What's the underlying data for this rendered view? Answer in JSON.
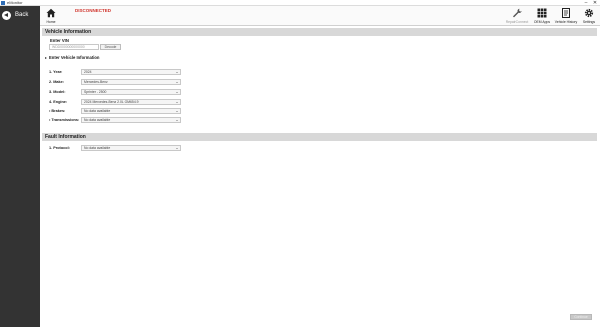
{
  "window": {
    "title": "eMonitor",
    "minimize": "–",
    "close": "✕"
  },
  "sidebar": {
    "back_label": "Back"
  },
  "toolbar": {
    "home_label": "Home",
    "status": "DISCONNECTED",
    "repair_connect_label": "RepairConnect",
    "oem_apps_label": "OEM Apps",
    "vehicle_history_label": "Vehicle History",
    "settings_label": "Settings"
  },
  "vehicle_info": {
    "header": "Vehicle Information",
    "vin_label": "Enter VIN",
    "vin_placeholder": "WDD0000000000000",
    "vin_button": "Decode",
    "enter_info_label": "Enter Vehicle Information",
    "fields": [
      {
        "label": "1. Year:",
        "value": "2024"
      },
      {
        "label": "2. Make:",
        "value": "Mercedes-Benz"
      },
      {
        "label": "3. Model:",
        "value": "Sprinter - 2500"
      },
      {
        "label": "4. Engine:",
        "value": "2024 Mercedes-Benz 2.0L OM654.9"
      },
      {
        "label": "• Brakes:",
        "value": "No data available"
      },
      {
        "label": "• Transmissions:",
        "value": "No data available"
      }
    ]
  },
  "fault_info": {
    "header": "Fault Information",
    "fields": [
      {
        "label": "1. Protocol:",
        "value": "No data available"
      }
    ]
  },
  "footer": {
    "continue_label": "Continue"
  },
  "colors": {
    "sidebar": "#333333",
    "status": "#d0342c",
    "section_header": "#d8d8d8"
  },
  "icons": [
    "home-icon",
    "wrench-icon",
    "grid-icon",
    "document-icon",
    "gear-icon",
    "back-arrow-icon"
  ]
}
